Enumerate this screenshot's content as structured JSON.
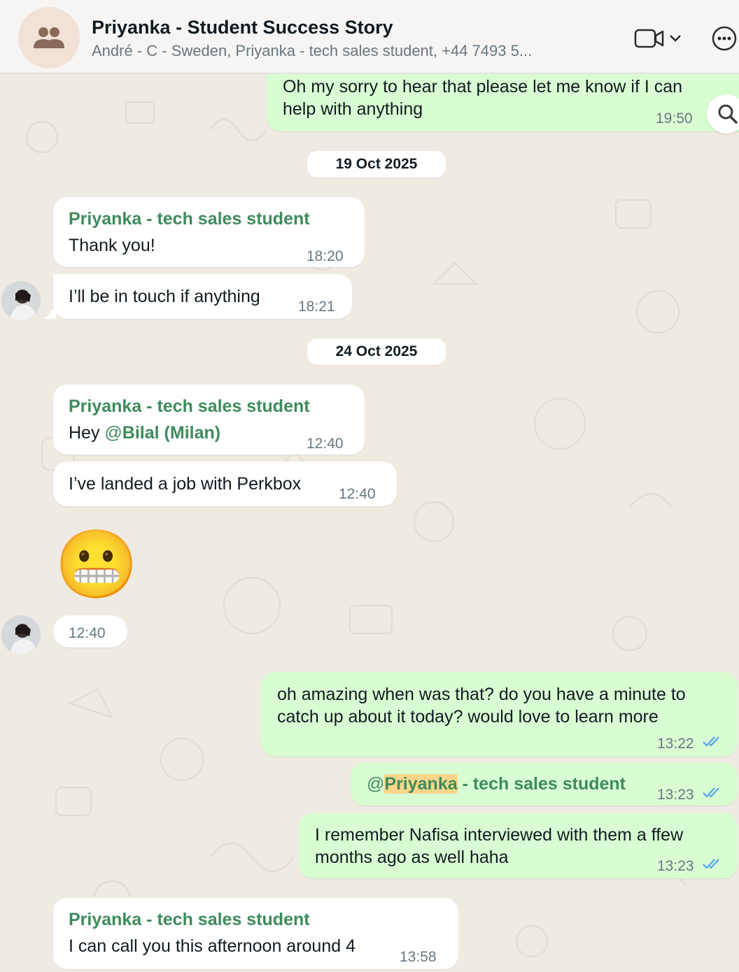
{
  "header": {
    "title": "Priyanka - Student Success Story",
    "subtitle": "André  - C - Sweden, Priyanka - tech sales student, +44 7493 5...",
    "avatar_icon": "group-icon",
    "video_icon": "video-call-icon",
    "more_icon": "more-options-icon"
  },
  "dates": {
    "d1": "19 Oct 2025",
    "d2": "24 Oct 2025"
  },
  "messages": {
    "m0": {
      "text_line1": "Oh my sorry to hear that please let me know if I can",
      "text_line2": "help with anything",
      "time": "19:50"
    },
    "m1": {
      "sender": "Priyanka - tech sales student",
      "text": "Thank you!",
      "time": "18:20"
    },
    "m2": {
      "text": "I’ll be in touch if anything",
      "time": "18:21"
    },
    "m3": {
      "sender": "Priyanka - tech sales student",
      "text_prefix": "Hey ",
      "at": "@",
      "mention": "Bilal (Milan)",
      "time": "12:40"
    },
    "m4": {
      "text": "I’ve landed a job with Perkbox",
      "time": "12:40"
    },
    "m5": {
      "emoji": "😬",
      "time": "12:40"
    },
    "m6": {
      "text_line1": "oh amazing when was that? do you have a minute to",
      "text_line2": "catch up about it today? would love to learn more",
      "time": "13:22"
    },
    "m7": {
      "at": "@",
      "mention": "Priyanka",
      "rest": " - tech sales student",
      "time": "13:23"
    },
    "m8": {
      "text_line1": "I remember Nafisa interviewed with them a ffew",
      "text_line2": "months ago as well haha",
      "time": "13:23"
    },
    "m9": {
      "sender": "Priyanka - tech sales student",
      "text": "I can call you this afternoon around 4",
      "time": "13:58"
    }
  },
  "colors": {
    "outgoing_bubble": "#d9fdd3",
    "incoming_bubble": "#ffffff",
    "sender_name": "#3e8b5c",
    "read_ticks": "#53a6e8",
    "chat_background": "#efeae2"
  }
}
